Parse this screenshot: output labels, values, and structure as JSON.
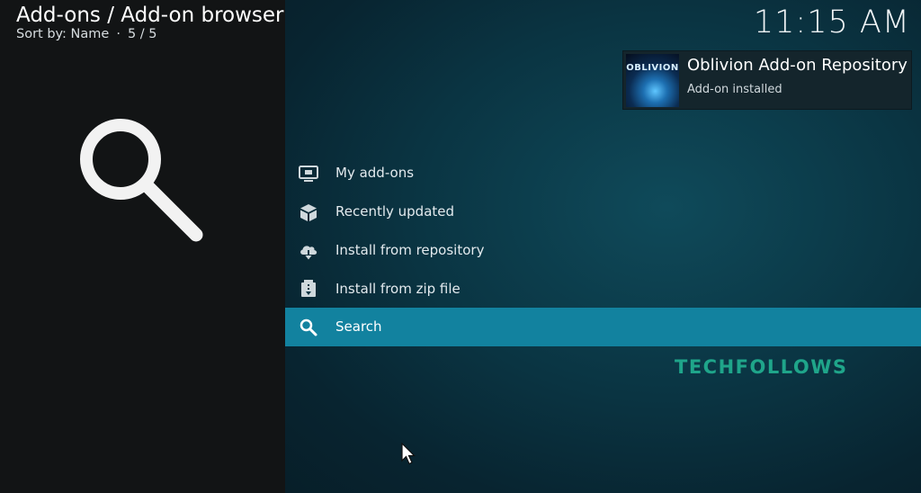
{
  "header": {
    "breadcrumb": "Add-ons / Add-on browser",
    "sort_label": "Sort by: Name",
    "separator": "·",
    "counter": "5 / 5",
    "clock": "11:15 AM"
  },
  "notification": {
    "title": "Oblivion Add-on Repository",
    "subtitle": "Add-on installed",
    "thumb_text": "OBLIVION"
  },
  "menu": {
    "items": [
      {
        "label": "My add-ons",
        "icon": "monitor-icon"
      },
      {
        "label": "Recently updated",
        "icon": "box-icon"
      },
      {
        "label": "Install from repository",
        "icon": "cloud-download-icon"
      },
      {
        "label": "Install from zip file",
        "icon": "zip-archive-icon"
      },
      {
        "label": "Search",
        "icon": "search-icon",
        "selected": true
      }
    ]
  },
  "watermark": "TECHFOLLOWS",
  "colors": {
    "selected_bg": "#12829f",
    "left_pane": "#121415",
    "watermark": "#1fa58a"
  }
}
